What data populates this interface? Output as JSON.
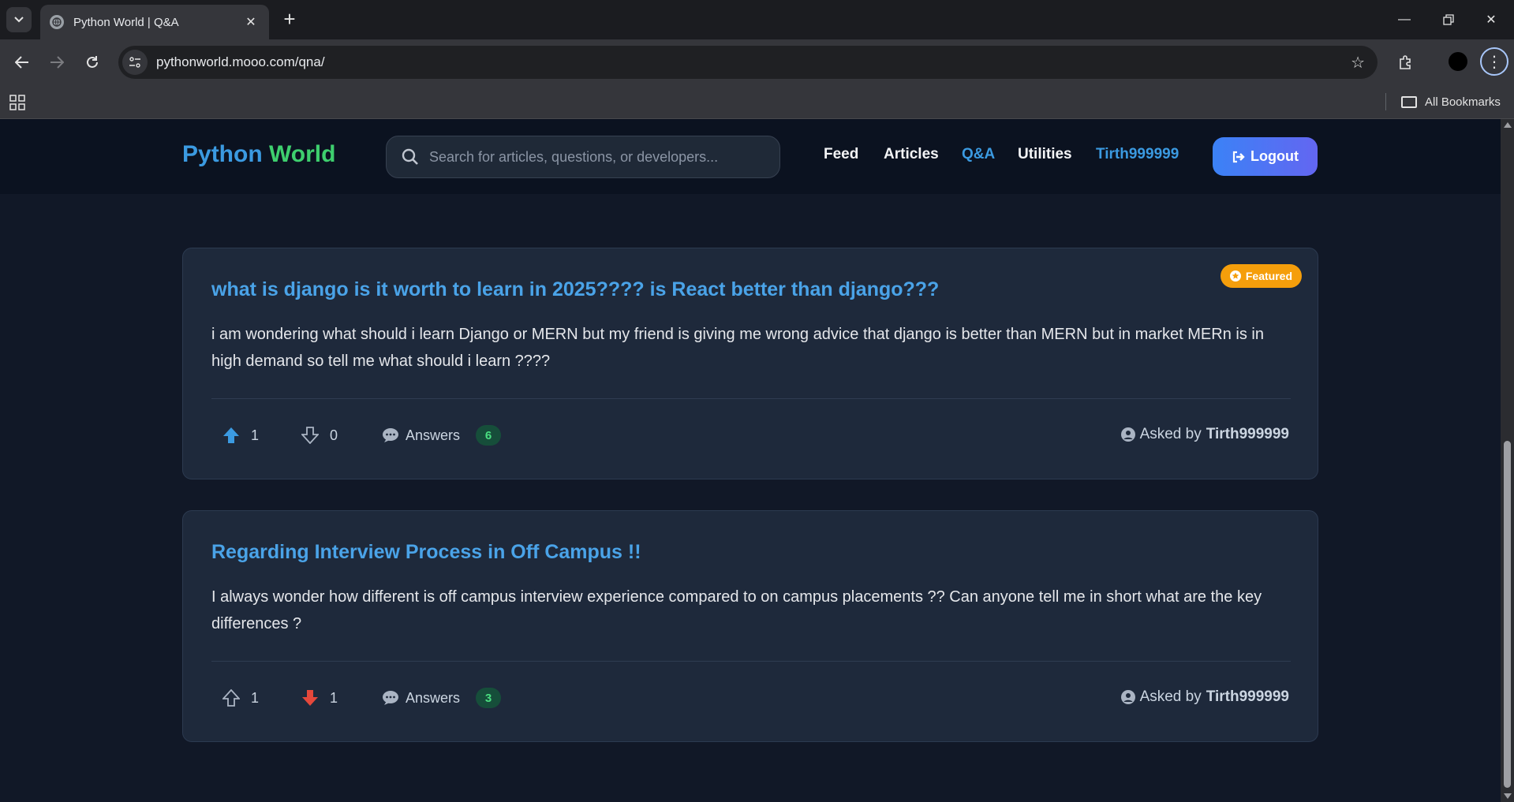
{
  "browser": {
    "tab_title": "Python World | Q&A",
    "url": "pythonworld.mooo.com/qna/",
    "bookmarks_label": "All Bookmarks"
  },
  "site": {
    "logo_part1": "Python",
    "logo_part2": "World",
    "search_placeholder": "Search for articles, questions, or developers...",
    "nav": {
      "feed": "Feed",
      "articles": "Articles",
      "qna": "Q&A",
      "utilities": "Utilities",
      "user": "Tirth999999"
    },
    "logout_label": "Logout"
  },
  "questions": [
    {
      "featured_label": "Featured",
      "title": "what is django is it worth to learn in 2025???? is React better than django???",
      "body": "i am wondering what should i learn Django or MERN but my friend is giving me wrong advice that django is better than MERN but in market MERn is in high demand so tell me what should i learn ????",
      "upvotes": "1",
      "downvotes": "0",
      "answers_label": "Answers",
      "answers_count": "6",
      "asked_by_label": "Asked by",
      "author": "Tirth999999",
      "upvote_color": "#3b9ae1"
    },
    {
      "title": "Regarding Interview Process in Off Campus !!",
      "body": "I always wonder how different is off campus interview experience compared to on campus placements ?? Can anyone tell me in short what are the key differences ?",
      "upvotes": "1",
      "downvotes": "1",
      "answers_label": "Answers",
      "answers_count": "3",
      "asked_by_label": "Asked by",
      "author": "Tirth999999",
      "downvote_color": "#e5483b"
    }
  ]
}
